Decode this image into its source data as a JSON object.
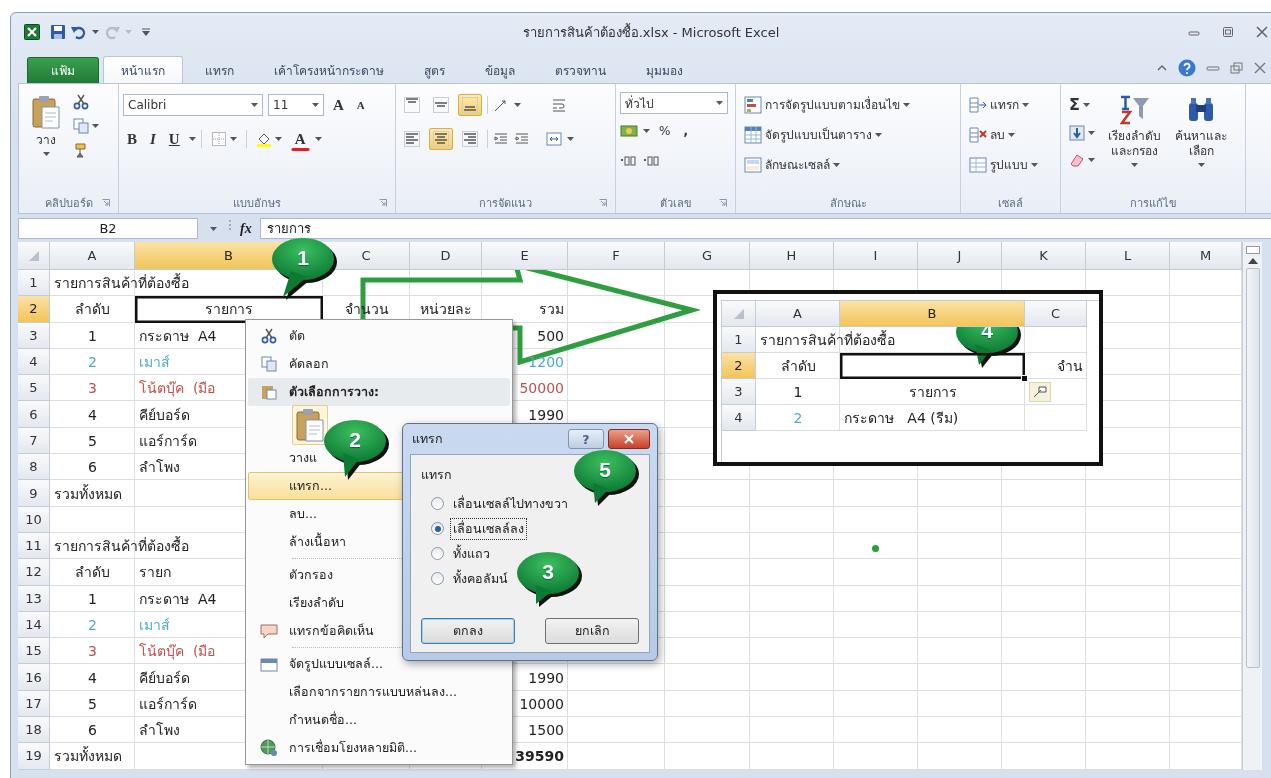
{
  "window": {
    "title": "รายการสินค้าต้องซื้อ.xlsx - Microsoft Excel"
  },
  "ribbon": {
    "tabs": [
      {
        "label": "แฟ้ม",
        "kind": "file",
        "selected": false
      },
      {
        "label": "หน้าแรก",
        "kind": "tab",
        "selected": true
      },
      {
        "label": "แทรก",
        "kind": "tab",
        "selected": false
      },
      {
        "label": "เค้าโครงหน้ากระดาษ",
        "kind": "tab",
        "selected": false
      },
      {
        "label": "สูตร",
        "kind": "tab",
        "selected": false
      },
      {
        "label": "ข้อมูล",
        "kind": "tab",
        "selected": false
      },
      {
        "label": "ตรวจทาน",
        "kind": "tab",
        "selected": false
      },
      {
        "label": "มุมมอง",
        "kind": "tab",
        "selected": false
      }
    ],
    "clipboard": {
      "label": "คลิปบอร์ด",
      "paste": "วาง"
    },
    "font": {
      "label": "แบบอักษร",
      "name": "Calibri",
      "size": "11",
      "grow": "A",
      "shrink": "A",
      "bold": "B",
      "italic": "I",
      "underline": "U",
      "color_button": "A"
    },
    "alignment": {
      "label": "การจัดแนว",
      "buttons": [
        {
          "selected": false
        },
        {
          "selected": false
        },
        {
          "selected": true
        },
        {
          "selected": false
        },
        {
          "selected": true
        },
        {
          "selected": false
        }
      ]
    },
    "number": {
      "label": "ตัวเลข",
      "format": "ทั่วไป",
      "percent": "%",
      "comma": ","
    },
    "styles": {
      "label": "ลักษณะ",
      "items": [
        "การจัดรูปแบบตามเงื่อนไข",
        "จัดรูปแบบเป็นตาราง",
        "ลักษณะเซลล์"
      ]
    },
    "cells": {
      "label": "เซลล์",
      "items": [
        "แทรก",
        "ลบ",
        "รูปแบบ"
      ]
    },
    "editing": {
      "label": "การแก้ไข",
      "autosum": "Σ",
      "sort": [
        "เรียงลำดับ",
        "และกรอง"
      ],
      "find": [
        "ค้นหาและ",
        "เลือก"
      ]
    }
  },
  "formula_bar": {
    "name_box": "B2",
    "fx": "fx",
    "value": "รายการ"
  },
  "sheet": {
    "columns": [
      {
        "label": "A",
        "selected": false
      },
      {
        "label": "B",
        "selected": true
      },
      {
        "label": "C",
        "selected": false
      },
      {
        "label": "D",
        "selected": false
      },
      {
        "label": "E",
        "selected": false
      },
      {
        "label": "F",
        "selected": false
      },
      {
        "label": "G",
        "selected": false
      },
      {
        "label": "H",
        "selected": false
      },
      {
        "label": "I",
        "selected": false
      },
      {
        "label": "J",
        "selected": false
      },
      {
        "label": "K",
        "selected": false
      },
      {
        "label": "L",
        "selected": false
      },
      {
        "label": "M",
        "selected": false
      }
    ],
    "rows": [
      {
        "number": "1",
        "selected": false,
        "cells": [
          {
            "text": "รายการสินค้าที่ต้องซื้อ",
            "kind": "title",
            "selected": false
          }
        ]
      },
      {
        "number": "2",
        "selected": true,
        "cells": [
          {
            "text": "ลำดับ",
            "kind": "heading",
            "selected": false
          },
          {
            "text": "รายการ",
            "kind": "heading",
            "selected": true
          },
          {
            "text": "จำนวน",
            "kind": "heading",
            "selected": false
          },
          {
            "text": "หน่วยละ",
            "kind": "heading",
            "selected": false
          },
          {
            "text": "รวม",
            "kind": "amount",
            "selected": false
          }
        ]
      },
      {
        "number": "3",
        "selected": false,
        "cells": [
          {
            "text": "1",
            "kind": "index",
            "selected": false
          },
          {
            "text": "กระดาษ  A4",
            "kind": "text",
            "selected": false
          },
          null,
          null,
          {
            "text": "500",
            "kind": "amount",
            "selected": false
          }
        ]
      },
      {
        "number": "4",
        "selected": false,
        "cells": [
          {
            "text": "2",
            "kind": "index",
            "selected": false,
            "color": "#4bacc6"
          },
          {
            "text": "เมาส์",
            "kind": "text",
            "selected": false,
            "color": "#4bacc6"
          },
          null,
          null,
          {
            "text": "1200",
            "kind": "amount",
            "selected": false,
            "color": "#4bacc6"
          }
        ]
      },
      {
        "number": "5",
        "selected": false,
        "cells": [
          {
            "text": "3",
            "kind": "index",
            "selected": false,
            "color": "#c0504d"
          },
          {
            "text": "โน้ตบุ๊ค  (มือ",
            "kind": "text",
            "selected": false,
            "color": "#c0504d"
          },
          null,
          null,
          {
            "text": "50000",
            "kind": "amount",
            "selected": false,
            "color": "#c0504d"
          }
        ]
      },
      {
        "number": "6",
        "selected": false,
        "cells": [
          {
            "text": "4",
            "kind": "index",
            "selected": false
          },
          {
            "text": "คีย์บอร์ด",
            "kind": "text",
            "selected": false
          },
          null,
          null,
          {
            "text": "1990",
            "kind": "amount",
            "selected": false
          }
        ]
      },
      {
        "number": "7",
        "selected": false,
        "cells": [
          {
            "text": "5",
            "kind": "index",
            "selected": false
          },
          {
            "text": "แอร์การ์ด",
            "kind": "text",
            "selected": false
          }
        ]
      },
      {
        "number": "8",
        "selected": false,
        "cells": [
          {
            "text": "6",
            "kind": "index",
            "selected": false
          },
          {
            "text": "ลำโพง",
            "kind": "text",
            "selected": false
          }
        ]
      },
      {
        "number": "9",
        "selected": false,
        "cells": [
          {
            "text": "รวมทั้งหมด",
            "kind": "label",
            "selected": false
          }
        ]
      },
      {
        "number": "10",
        "selected": false
      },
      {
        "number": "11",
        "selected": false,
        "cells": [
          {
            "text": "รายการสินค้าที่ต้องซื้อ",
            "kind": "title",
            "selected": false
          }
        ]
      },
      {
        "number": "12",
        "selected": false,
        "cells": [
          {
            "text": "ลำดับ",
            "kind": "heading",
            "selected": false
          },
          {
            "text": "รายก",
            "kind": "text",
            "selected": false
          }
        ]
      },
      {
        "number": "13",
        "selected": false,
        "cells": [
          {
            "text": "1",
            "kind": "index",
            "selected": false
          },
          {
            "text": "กระดาษ  A4",
            "kind": "text",
            "selected": false
          }
        ]
      },
      {
        "number": "14",
        "selected": false,
        "cells": [
          {
            "text": "2",
            "kind": "index",
            "selected": false,
            "color": "#4bacc6"
          },
          {
            "text": "เมาส์",
            "kind": "text",
            "selected": false,
            "color": "#4bacc6"
          }
        ]
      },
      {
        "number": "15",
        "selected": false,
        "cells": [
          {
            "text": "3",
            "kind": "index",
            "selected": false,
            "color": "#c0504d"
          },
          {
            "text": "โน้ตบุ๊ค  (มือ",
            "kind": "text",
            "selected": false,
            "color": "#c0504d"
          }
        ]
      },
      {
        "number": "16",
        "selected": false,
        "cells": [
          {
            "text": "4",
            "kind": "index",
            "selected": false
          },
          {
            "text": "คีย์บอร์ด",
            "kind": "text",
            "selected": false
          },
          null,
          null,
          {
            "text": "1990",
            "kind": "amount",
            "selected": false
          }
        ]
      },
      {
        "number": "17",
        "selected": false,
        "cells": [
          {
            "text": "5",
            "kind": "index",
            "selected": false
          },
          {
            "text": "แอร์การ์ด",
            "kind": "text",
            "selected": false
          },
          null,
          null,
          {
            "text": "10000",
            "kind": "amount",
            "selected": false
          }
        ]
      },
      {
        "number": "18",
        "selected": false,
        "cells": [
          {
            "text": "6",
            "kind": "index",
            "selected": false
          },
          {
            "text": "ลำโพง",
            "kind": "text",
            "selected": false
          },
          null,
          null,
          {
            "text": "1500",
            "kind": "amount",
            "selected": false
          }
        ]
      },
      {
        "number": "19",
        "selected": false,
        "cells": [
          {
            "text": "รวมทั้งหมด",
            "kind": "label",
            "selected": false
          },
          null,
          null,
          null,
          {
            "text": "39590",
            "kind": "total",
            "selected": false
          }
        ]
      }
    ]
  },
  "context_menu": {
    "items": [
      {
        "kind": "item",
        "label": "ตัด",
        "selected": false
      },
      {
        "kind": "item",
        "label": "คัดลอก",
        "selected": false
      },
      {
        "kind": "header",
        "label": "ตัวเลือกการวาง:"
      },
      {
        "kind": "paste-icons"
      },
      {
        "kind": "item",
        "label": "วางแ",
        "selected": false
      },
      {
        "kind": "item",
        "label": "แทรก...",
        "selected": true
      },
      {
        "kind": "item",
        "label": "ลบ...",
        "selected": false
      },
      {
        "kind": "item",
        "label": "ล้างเนื้อหา",
        "selected": false
      },
      {
        "kind": "separator"
      },
      {
        "kind": "item",
        "label": "ตัวกรอง",
        "selected": false
      },
      {
        "kind": "item",
        "label": "เรียงลำดับ",
        "selected": false
      },
      {
        "kind": "item",
        "label": "แทรกข้อคิดเห็น",
        "selected": false
      },
      {
        "kind": "separator"
      },
      {
        "kind": "item",
        "label": "จัดรูปแบบเซลล์...",
        "selected": false
      },
      {
        "kind": "item",
        "label": "เลือกจากรายการแบบหล่นลง...",
        "selected": false
      },
      {
        "kind": "item",
        "label": "กำหนดชื่อ...",
        "selected": false
      },
      {
        "kind": "item",
        "label": "การเชื่อมโยงหลายมิติ...",
        "selected": false
      }
    ]
  },
  "dialog": {
    "title": "แทรก",
    "help": "?",
    "group_label": "แทรก",
    "options": [
      {
        "label": "เลื่อนเซลล์ไปทางขวา",
        "selected": false
      },
      {
        "label": "เลื่อนเซลล์ลง",
        "selected": true
      },
      {
        "label": "ทั้งแถว",
        "selected": false
      },
      {
        "label": "ทั้งคอลัมน์",
        "selected": false
      }
    ],
    "buttons": [
      "ตกลง",
      "ยกเลิก"
    ]
  },
  "inset": {
    "columns": [
      {
        "label": "A",
        "selected": false
      },
      {
        "label": "B",
        "selected": true
      },
      {
        "label": "C",
        "selected": false
      }
    ],
    "rows": [
      {
        "number": "1",
        "selected": false,
        "cells": [
          {
            "text": "รายการสินค้าที่ต้องซื้อ",
            "kind": "title",
            "selected": false
          }
        ]
      },
      {
        "number": "2",
        "selected": true,
        "cells": [
          {
            "text": "ลำดับ",
            "kind": "heading",
            "selected": false
          },
          {
            "kind": "text",
            "selected": true
          },
          {
            "text": "จำน",
            "kind": "amount",
            "selected": false
          }
        ]
      },
      {
        "number": "3",
        "selected": false,
        "cells": [
          {
            "text": "1",
            "kind": "index",
            "selected": false
          },
          {
            "text": "รายการ",
            "kind": "heading",
            "selected": false
          },
          {
            "kind": "paste-options",
            "selected": false
          }
        ]
      },
      {
        "number": "4",
        "selected": false,
        "cells": [
          {
            "text": "2",
            "kind": "index",
            "selected": false,
            "color": "#4bacc6"
          },
          {
            "text": "กระดาษ   A4 (รีม)",
            "kind": "text",
            "selected": false
          }
        ]
      }
    ]
  },
  "callouts": [
    "1",
    "2",
    "3",
    "4",
    "5"
  ]
}
